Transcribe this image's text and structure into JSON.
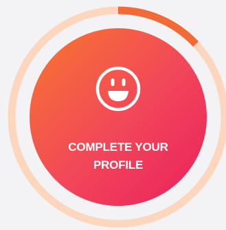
{
  "profile_completion": {
    "progress_fraction": 0.13,
    "cta_label": "COMPLETE YOUR PROFILE",
    "icon": "smiley-face-icon"
  },
  "colors": {
    "background": "#f3f3f5",
    "track": "#fcd7bd",
    "progress": "#f26a36",
    "gradient_start": "#f7782f",
    "gradient_mid": "#f2455a",
    "gradient_end": "#ea1f5c",
    "text": "#ffffff"
  }
}
